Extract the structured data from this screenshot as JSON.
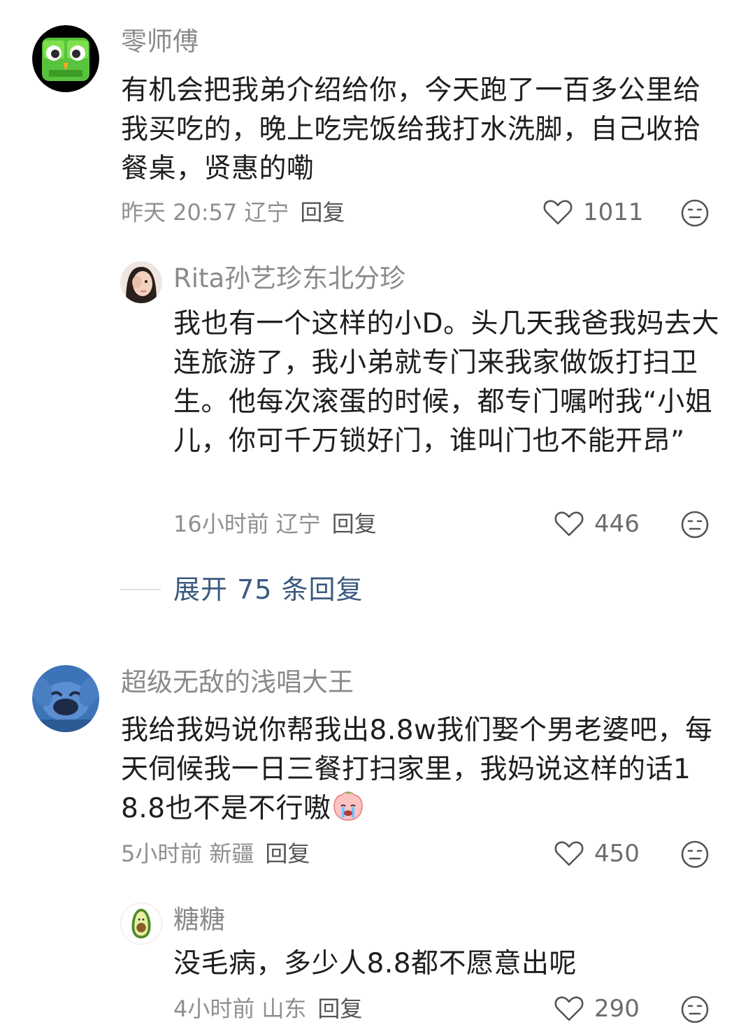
{
  "comments": [
    {
      "username": "零师傅",
      "content": "有机会把我弟介绍给你，今天跑了一百多公里给我买吃的，晚上吃完饭给我打水洗脚，自己收拾餐桌，贤惠的嘞",
      "time": "昨天 20:57",
      "location": "辽宁",
      "reply_label": "回复",
      "likes": "1011",
      "avatar_icon": "green-owl-avatar"
    },
    {
      "username": "Rita孙艺珍东北分珍",
      "content": "我也有一个这样的小D。头几天我爸我妈去大连旅游了，我小弟就专门来我家做饭打扫卫生。他每次滚蛋的时候，都专门嘱咐我“小姐儿，你可千万锁好门，谁叫门也不能开昂”",
      "time": "16小时前",
      "location": "辽宁",
      "reply_label": "回复",
      "likes": "446",
      "avatar_icon": "girl-photo-avatar"
    },
    {
      "username": "超级无敌的浅唱大王",
      "content": "我给我妈说你帮我出8.8w我们娶个男老婆吧，每天伺候我一日三餐打扫家里，我妈说这样的话18.8也不是不行嗷",
      "time": "5小时前",
      "location": "新疆",
      "reply_label": "回复",
      "likes": "450",
      "avatar_icon": "stitch-avatar"
    },
    {
      "username": "糖糖",
      "content": "没毛病，多少人8.8都不愿意出呢",
      "time": "4小时前",
      "location": "山东",
      "reply_label": "回复",
      "likes": "290",
      "avatar_icon": "avocado-avatar"
    }
  ],
  "expand_replies": "展开 75 条回复",
  "colors": {
    "username": "#8a8a8a",
    "content": "#1e1e1e",
    "meta": "#8f8f8f",
    "expand_link": "#3b5a7f",
    "icon_stroke": "#555555"
  }
}
